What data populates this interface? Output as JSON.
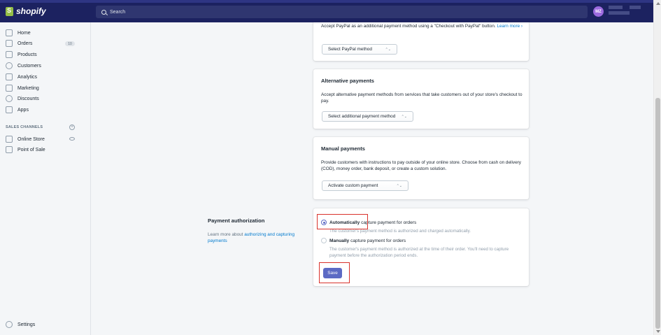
{
  "header": {
    "logo_text": "shopify",
    "search_placeholder": "Search",
    "avatar_initials": "MZ"
  },
  "sidebar": {
    "items": [
      {
        "label": "Home",
        "icon": "home-icon"
      },
      {
        "label": "Orders",
        "icon": "orders-icon",
        "badge": "10"
      },
      {
        "label": "Products",
        "icon": "tag-icon"
      },
      {
        "label": "Customers",
        "icon": "person-icon"
      },
      {
        "label": "Analytics",
        "icon": "chart-icon"
      },
      {
        "label": "Marketing",
        "icon": "megaphone-icon"
      },
      {
        "label": "Discounts",
        "icon": "discount-icon"
      },
      {
        "label": "Apps",
        "icon": "apps-icon"
      }
    ],
    "sales_channels_title": "SALES CHANNELS",
    "channels": [
      {
        "label": "Online Store",
        "icon": "store-icon"
      },
      {
        "label": "Point of Sale",
        "icon": "pos-icon"
      }
    ],
    "settings_label": "Settings"
  },
  "paypal": {
    "text": "Accept PayPal as an additional payment method using a \"Checkout with PayPal\" button.",
    "learn_more": "Learn more",
    "select_label": "Select PayPal method"
  },
  "alt_payments": {
    "title": "Alternative payments",
    "text": "Accept alternative payment methods from services that take customers out of your store's checkout to pay.",
    "select_label": "Select additional payment method"
  },
  "manual_payments": {
    "title": "Manual payments",
    "text": "Provide customers with instructions to pay outside of your online store. Choose from cash on delivery (COD), money order, bank deposit, or create a custom solution.",
    "select_label": "Activate custom payment"
  },
  "payment_auth": {
    "title": "Payment authorization",
    "desc_prefix": "Learn more about",
    "desc_link": "authorizing and capturing payments",
    "auto_bold": "Automatically",
    "auto_rest": "capture payment for orders",
    "auto_help": "The customer's payment method is authorized and charged automatically.",
    "manual_bold": "Manually",
    "manual_rest": "capture payment for orders",
    "manual_help": "The customer's payment method is authorized at the time of their order. You'll need to capture payment before the authorization period ends.",
    "selected": "automatic",
    "save_label": "Save"
  },
  "colors": {
    "topbar": "#1c2260",
    "primary": "#5c6ac4",
    "highlight": "#d9322c"
  }
}
